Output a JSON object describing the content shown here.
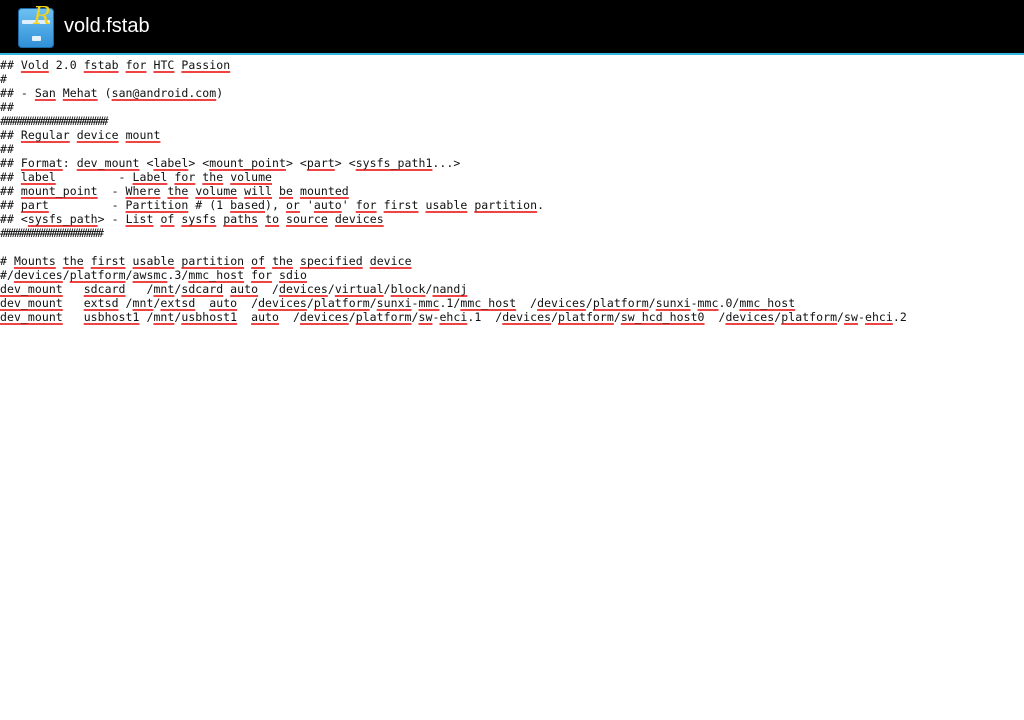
{
  "app": {
    "title": "vold.fstab",
    "icon": "root-explorer-cabinet-icon",
    "accent_color": "#33b5e5",
    "spellcheck_color": "#ee4444"
  },
  "editor": {
    "lines": [
      [
        {
          "t": "## "
        },
        {
          "t": "Vold",
          "u": 1
        },
        {
          "t": " 2.0 "
        },
        {
          "t": "fstab",
          "u": 1
        },
        {
          "t": " "
        },
        {
          "t": "for",
          "u": 1
        },
        {
          "t": " "
        },
        {
          "t": "HTC",
          "u": 1
        },
        {
          "t": " "
        },
        {
          "t": "Passion",
          "u": 1
        }
      ],
      [
        {
          "t": "#"
        }
      ],
      [
        {
          "t": "## - "
        },
        {
          "t": "San",
          "u": 1
        },
        {
          "t": " "
        },
        {
          "t": "Mehat",
          "u": 1
        },
        {
          "t": " ("
        },
        {
          "t": "san@android.com",
          "u": 1
        },
        {
          "t": ")"
        }
      ],
      [
        {
          "t": "##"
        }
      ],
      [
        {
          "t": "#######################",
          "h": 1
        }
      ],
      [
        {
          "t": "## "
        },
        {
          "t": "Regular",
          "u": 1
        },
        {
          "t": " "
        },
        {
          "t": "device",
          "u": 1
        },
        {
          "t": " "
        },
        {
          "t": "mount",
          "u": 1
        }
      ],
      [
        {
          "t": "##"
        }
      ],
      [
        {
          "t": "## "
        },
        {
          "t": "Format",
          "u": 1
        },
        {
          "t": ": "
        },
        {
          "t": "dev_mount",
          "u": 1
        },
        {
          "t": " <"
        },
        {
          "t": "label",
          "u": 1
        },
        {
          "t": "> <"
        },
        {
          "t": "mount_point",
          "u": 1
        },
        {
          "t": "> <"
        },
        {
          "t": "part",
          "u": 1
        },
        {
          "t": "> <"
        },
        {
          "t": "sysfs_path1",
          "u": 1
        },
        {
          "t": "...>"
        }
      ],
      [
        {
          "t": "## "
        },
        {
          "t": "label",
          "u": 1
        },
        {
          "t": "         - "
        },
        {
          "t": "Label",
          "u": 1
        },
        {
          "t": " "
        },
        {
          "t": "for",
          "u": 1
        },
        {
          "t": " "
        },
        {
          "t": "the",
          "u": 1
        },
        {
          "t": " "
        },
        {
          "t": "volume",
          "u": 1
        }
      ],
      [
        {
          "t": "## "
        },
        {
          "t": "mount_point",
          "u": 1
        },
        {
          "t": "  - "
        },
        {
          "t": "Where",
          "u": 1
        },
        {
          "t": " "
        },
        {
          "t": "the",
          "u": 1
        },
        {
          "t": " "
        },
        {
          "t": "volume",
          "u": 1
        },
        {
          "t": " "
        },
        {
          "t": "will",
          "u": 1
        },
        {
          "t": " "
        },
        {
          "t": "be",
          "u": 1
        },
        {
          "t": " "
        },
        {
          "t": "mounted",
          "u": 1
        }
      ],
      [
        {
          "t": "## "
        },
        {
          "t": "part",
          "u": 1
        },
        {
          "t": "         - "
        },
        {
          "t": "Partition",
          "u": 1
        },
        {
          "t": " # (1 "
        },
        {
          "t": "based",
          "u": 1
        },
        {
          "t": "), "
        },
        {
          "t": "or",
          "u": 1
        },
        {
          "t": " '"
        },
        {
          "t": "auto",
          "u": 1
        },
        {
          "t": "' "
        },
        {
          "t": "for",
          "u": 1
        },
        {
          "t": " "
        },
        {
          "t": "first",
          "u": 1
        },
        {
          "t": " "
        },
        {
          "t": "usable",
          "u": 1
        },
        {
          "t": " "
        },
        {
          "t": "partition",
          "u": 1
        },
        {
          "t": "."
        }
      ],
      [
        {
          "t": "## <"
        },
        {
          "t": "sysfs_path",
          "u": 1
        },
        {
          "t": "> - "
        },
        {
          "t": "List",
          "u": 1
        },
        {
          "t": " "
        },
        {
          "t": "of",
          "u": 1
        },
        {
          "t": " "
        },
        {
          "t": "sysfs",
          "u": 1
        },
        {
          "t": " "
        },
        {
          "t": "paths",
          "u": 1
        },
        {
          "t": " "
        },
        {
          "t": "to",
          "u": 1
        },
        {
          "t": " "
        },
        {
          "t": "source",
          "u": 1
        },
        {
          "t": " "
        },
        {
          "t": "devices",
          "u": 1
        }
      ],
      [
        {
          "t": "######################",
          "h": 1
        }
      ],
      [
        {
          "t": ""
        }
      ],
      [
        {
          "t": "# "
        },
        {
          "t": "Mounts",
          "u": 1
        },
        {
          "t": " "
        },
        {
          "t": "the",
          "u": 1
        },
        {
          "t": " "
        },
        {
          "t": "first",
          "u": 1
        },
        {
          "t": " "
        },
        {
          "t": "usable",
          "u": 1
        },
        {
          "t": " "
        },
        {
          "t": "partition",
          "u": 1
        },
        {
          "t": " "
        },
        {
          "t": "of",
          "u": 1
        },
        {
          "t": " "
        },
        {
          "t": "the",
          "u": 1
        },
        {
          "t": " "
        },
        {
          "t": "specified",
          "u": 1
        },
        {
          "t": " "
        },
        {
          "t": "device",
          "u": 1
        }
      ],
      [
        {
          "t": "#/"
        },
        {
          "t": "devices",
          "u": 1
        },
        {
          "t": "/"
        },
        {
          "t": "platform",
          "u": 1
        },
        {
          "t": "/"
        },
        {
          "t": "awsmc",
          "u": 1
        },
        {
          "t": ".3/"
        },
        {
          "t": "mmc_host",
          "u": 1
        },
        {
          "t": " "
        },
        {
          "t": "for",
          "u": 1
        },
        {
          "t": " "
        },
        {
          "t": "sdio",
          "u": 1
        }
      ],
      [
        {
          "t": "dev_mount",
          "u": 1
        },
        {
          "t": "   "
        },
        {
          "t": "sdcard",
          "u": 1
        },
        {
          "t": "   /"
        },
        {
          "t": "mnt",
          "u": 1
        },
        {
          "t": "/"
        },
        {
          "t": "sdcard",
          "u": 1
        },
        {
          "t": " "
        },
        {
          "t": "auto",
          "u": 1
        },
        {
          "t": "  /"
        },
        {
          "t": "devices",
          "u": 1
        },
        {
          "t": "/"
        },
        {
          "t": "virtual",
          "u": 1
        },
        {
          "t": "/"
        },
        {
          "t": "block",
          "u": 1
        },
        {
          "t": "/"
        },
        {
          "t": "nandj",
          "u": 1
        }
      ],
      [
        {
          "t": "dev_mount",
          "u": 1
        },
        {
          "t": "   "
        },
        {
          "t": "extsd",
          "u": 1
        },
        {
          "t": " /"
        },
        {
          "t": "mnt",
          "u": 1
        },
        {
          "t": "/"
        },
        {
          "t": "extsd",
          "u": 1
        },
        {
          "t": "  "
        },
        {
          "t": "auto",
          "u": 1
        },
        {
          "t": "  /"
        },
        {
          "t": "devices",
          "u": 1
        },
        {
          "t": "/"
        },
        {
          "t": "platform",
          "u": 1
        },
        {
          "t": "/"
        },
        {
          "t": "sunxi",
          "u": 1
        },
        {
          "t": "-"
        },
        {
          "t": "mmc",
          "u": 1
        },
        {
          "t": ".1/"
        },
        {
          "t": "mmc_host",
          "u": 1
        },
        {
          "t": "  /"
        },
        {
          "t": "devices",
          "u": 1
        },
        {
          "t": "/"
        },
        {
          "t": "platform",
          "u": 1
        },
        {
          "t": "/"
        },
        {
          "t": "sunxi",
          "u": 1
        },
        {
          "t": "-"
        },
        {
          "t": "mmc",
          "u": 1
        },
        {
          "t": ".0/"
        },
        {
          "t": "mmc_host",
          "u": 1
        }
      ],
      [
        {
          "t": "dev_mount",
          "u": 1
        },
        {
          "t": "   "
        },
        {
          "t": "usbhost1",
          "u": 1
        },
        {
          "t": " /"
        },
        {
          "t": "mnt",
          "u": 1
        },
        {
          "t": "/"
        },
        {
          "t": "usbhost1",
          "u": 1
        },
        {
          "t": "  "
        },
        {
          "t": "auto",
          "u": 1
        },
        {
          "t": "  /"
        },
        {
          "t": "devices",
          "u": 1
        },
        {
          "t": "/"
        },
        {
          "t": "platform",
          "u": 1
        },
        {
          "t": "/"
        },
        {
          "t": "sw",
          "u": 1
        },
        {
          "t": "-"
        },
        {
          "t": "ehci",
          "u": 1
        },
        {
          "t": ".1  /"
        },
        {
          "t": "devices",
          "u": 1
        },
        {
          "t": "/"
        },
        {
          "t": "platform",
          "u": 1
        },
        {
          "t": "/"
        },
        {
          "t": "sw_hcd_host0",
          "u": 1
        },
        {
          "t": "  /"
        },
        {
          "t": "devices",
          "u": 1
        },
        {
          "t": "/"
        },
        {
          "t": "platform",
          "u": 1
        },
        {
          "t": "/"
        },
        {
          "t": "sw",
          "u": 1
        },
        {
          "t": "-"
        },
        {
          "t": "ehci",
          "u": 1
        },
        {
          "t": ".2"
        }
      ]
    ]
  }
}
